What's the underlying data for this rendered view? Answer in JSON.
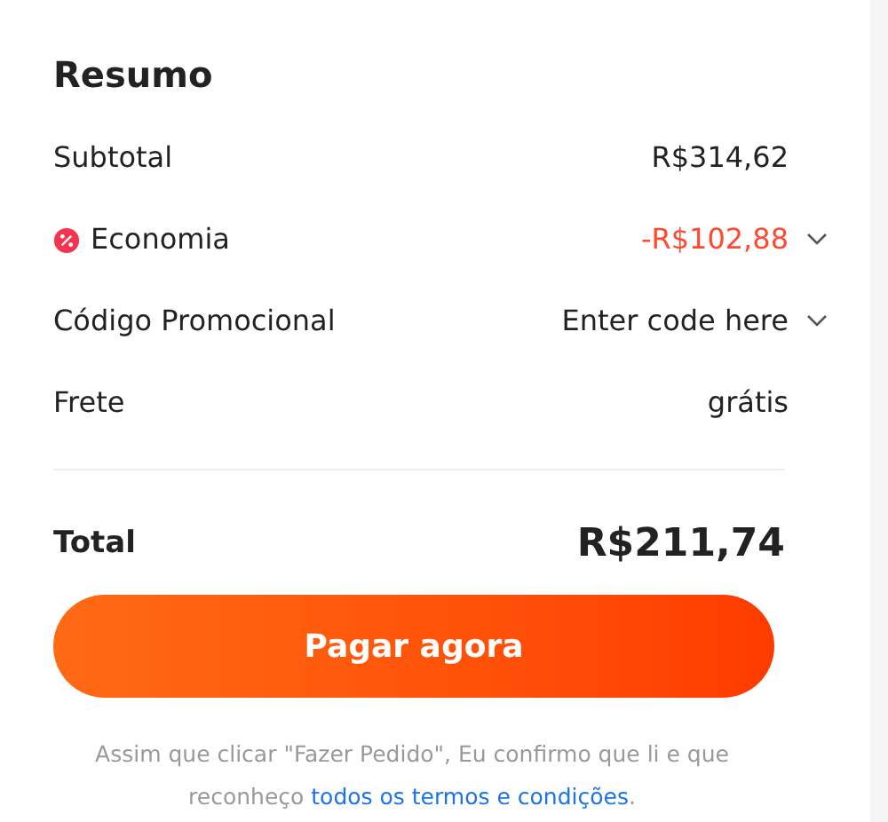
{
  "title": "Resumo",
  "rows": [
    {
      "kind": "plain",
      "label": "Subtotal",
      "value": "R$314,62"
    },
    {
      "kind": "discount",
      "label": "Economia",
      "value": "-R$102,88"
    },
    {
      "kind": "promo",
      "label": "Código Promocional",
      "value": "Enter code here"
    },
    {
      "kind": "plain",
      "label": "Frete",
      "value": "grátis"
    }
  ],
  "total": {
    "label": "Total",
    "value": "R$211,74"
  },
  "pay_button": "Pagar agora",
  "note": {
    "text": "Assim que clicar \"Fazer Pedido\", Eu confirmo que li e que reconheço",
    "link": "todos os termos e condições",
    "end": "."
  }
}
